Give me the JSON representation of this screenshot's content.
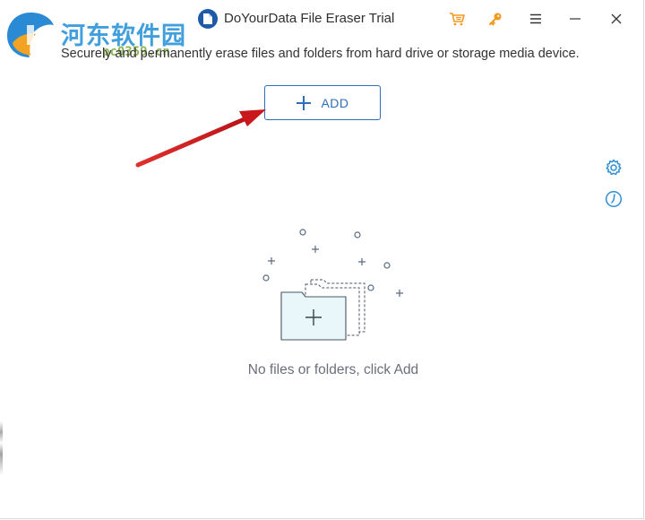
{
  "watermark": {
    "brand": "河东软件园",
    "url": "pc0359.cn"
  },
  "window": {
    "title": "DoYourData File Eraser Trial",
    "toolbar_icons": [
      "cart-icon",
      "key-icon",
      "menu-icon",
      "minimize-icon",
      "close-icon"
    ]
  },
  "main": {
    "subtitle": "Securely and permanently erase files and folders from hard drive or storage media device.",
    "add_button_label": "ADD",
    "empty_state": "No files or folders, click Add"
  },
  "side_icons": [
    "settings-icon",
    "history-icon"
  ],
  "colors": {
    "accent": "#2f6fb5",
    "toolbar_orange": "#f39a1e",
    "annotation_arrow": "#d9211f",
    "folder_fill": "#e9f6fa"
  }
}
